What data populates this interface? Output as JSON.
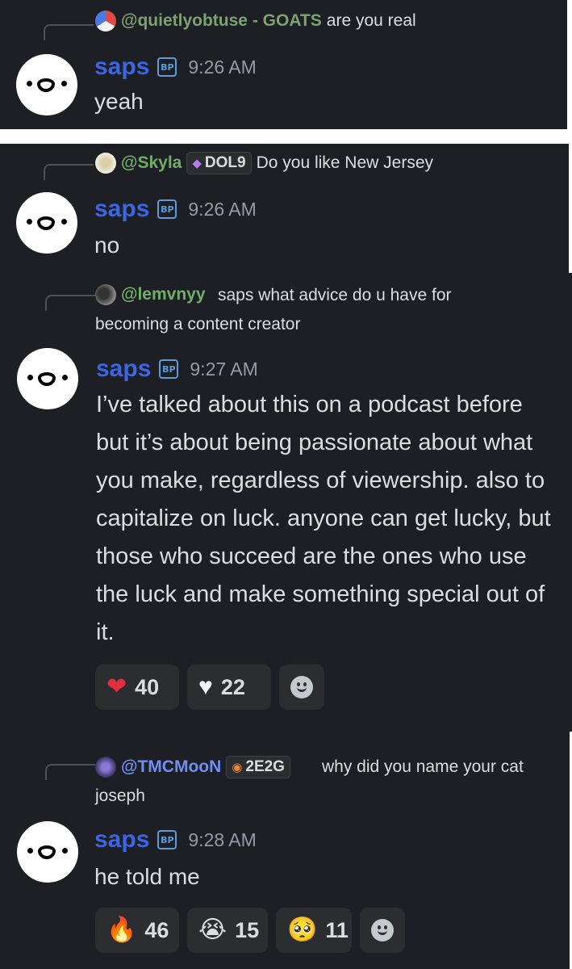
{
  "messages": [
    {
      "reply": {
        "mention": "@quietlyobtuse - GOATS",
        "text": "are you real"
      },
      "author": "saps",
      "badge": "BP",
      "time": "9:26 AM",
      "content": "yeah"
    },
    {
      "reply": {
        "mention": "@Skyla",
        "tag": "DOL9",
        "text": "Do you like New Jersey"
      },
      "author": "saps",
      "badge": "BP",
      "time": "9:26 AM",
      "content": "no"
    },
    {
      "reply": {
        "mention": "@lemvnyy",
        "text": "saps what advice do u have for becoming a content creator"
      },
      "author": "saps",
      "badge": "BP",
      "time": "9:27 AM",
      "content": "I’ve talked about this on a podcast before but it’s about being passionate about what you make, regardless of viewership. also to capitalize on luck. anyone can get lucky, but those who succeed are the ones who use the luck and make something special out of it.",
      "reactions": [
        {
          "emoji": "red-heart",
          "glyph": "❤",
          "color": "#e0303f",
          "count": "40"
        },
        {
          "emoji": "white-heart",
          "glyph": "♥",
          "color": "#f2f3f5",
          "count": "22"
        }
      ]
    },
    {
      "reply": {
        "mention": "@TMCMooN",
        "tag": "2E2G",
        "text": "why did you name your cat joseph"
      },
      "author": "saps",
      "badge": "BP",
      "time": "9:28 AM",
      "content": "he told me",
      "reactions": [
        {
          "emoji": "fire",
          "glyph": "🔥",
          "count": "46"
        },
        {
          "emoji": "loudly-crying-face",
          "glyph": "😭",
          "count": "15"
        },
        {
          "emoji": "pleading-face",
          "glyph": "🥺",
          "count": "11"
        }
      ]
    }
  ],
  "colors": {
    "background": "#1e1f24",
    "username": "#3b66e3",
    "text": "#dbdee1",
    "timestamp": "#949ba4"
  }
}
